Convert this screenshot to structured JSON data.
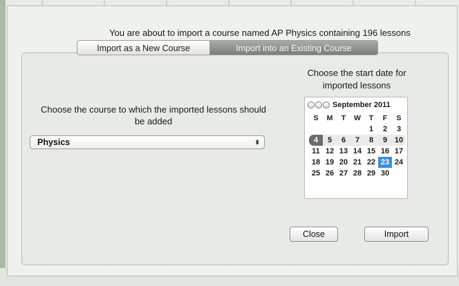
{
  "dialog": {
    "message": "You are about to import a course named AP Physics containing 196 lessons",
    "tabs": [
      {
        "label": "Import as a New Course",
        "selected": false
      },
      {
        "label": "Import into an Existing Course",
        "selected": true
      }
    ],
    "prompt": "Choose the course to which the imported lessons should be added",
    "course_popup": {
      "value": "Physics"
    },
    "calendar_title": "Choose the start date for imported lessons",
    "calendar": {
      "month_label": "September 2011",
      "weekdays": [
        "S",
        "M",
        "T",
        "W",
        "T",
        "F",
        "S"
      ],
      "weeks": [
        [
          "",
          "",
          "",
          "",
          "1",
          "2",
          "3"
        ],
        [
          "4",
          "5",
          "6",
          "7",
          "8",
          "9",
          "10"
        ],
        [
          "11",
          "12",
          "13",
          "14",
          "15",
          "16",
          "17"
        ],
        [
          "18",
          "19",
          "20",
          "21",
          "22",
          "23",
          "24"
        ],
        [
          "25",
          "26",
          "27",
          "28",
          "29",
          "30",
          ""
        ]
      ],
      "today": "4",
      "selected": "23"
    },
    "buttons": {
      "close": "Close",
      "import": "Import"
    }
  },
  "colors": {
    "selection": "#3f8fd8",
    "selected_tab": "#8a8c87"
  },
  "icons": {
    "popup_arrows": "updown-arrows-icon"
  }
}
